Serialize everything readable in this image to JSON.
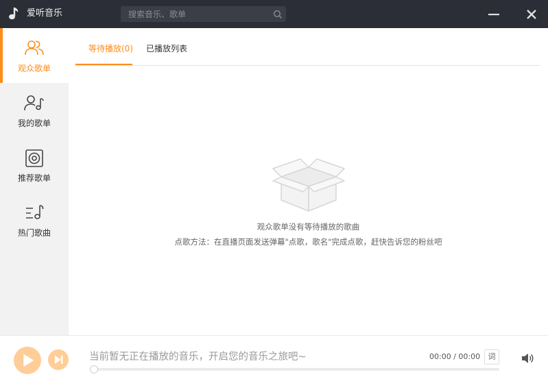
{
  "app": {
    "title": "爱听音乐",
    "logo_icon": "music-note-icon"
  },
  "search": {
    "placeholder": "搜索音乐、歌单",
    "value": ""
  },
  "window_controls": {
    "minimize_icon": "minimize-icon",
    "close_icon": "close-icon"
  },
  "sidebar": {
    "items": [
      {
        "label": "观众歌单",
        "icon": "audience-users-icon",
        "active": true
      },
      {
        "label": "我的歌单",
        "icon": "user-music-icon",
        "active": false
      },
      {
        "label": "推荐歌单",
        "icon": "speaker-icon",
        "active": false
      },
      {
        "label": "热门歌曲",
        "icon": "hot-music-icon",
        "active": false
      }
    ]
  },
  "tabs": [
    {
      "label": "等待播放(0)",
      "active": true
    },
    {
      "label": "已播放列表",
      "active": false
    }
  ],
  "empty_state": {
    "icon": "empty-box-icon",
    "message": "观众歌单没有等待播放的歌曲",
    "hint": "点歌方法：在直播页面发送弹幕\"点歌，歌名\"完成点歌，赶快告诉您的粉丝吧"
  },
  "player": {
    "now_playing": "当前暂无正在播放的音乐，开启您的音乐之旅吧~",
    "time": "00:00 / 00:00",
    "lyrics_label": "词",
    "progress": 0,
    "play_icon": "play-icon",
    "next_icon": "next-track-icon",
    "volume_icon": "volume-icon"
  },
  "colors": {
    "accent": "#ff8c1a",
    "accent_light": "#ffcd97",
    "titlebar": "#2b2e36",
    "sidebar_bg": "#f2f2f2"
  }
}
